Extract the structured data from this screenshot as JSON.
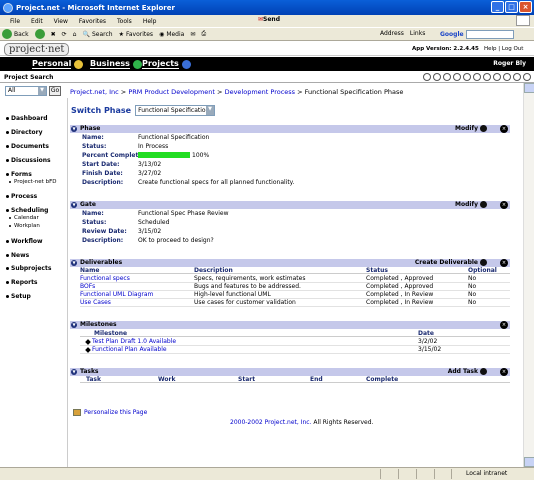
{
  "window": {
    "title": "Project.net - Microsoft Internet Explorer"
  },
  "browser_menu": [
    "File",
    "Edit",
    "View",
    "Favorites",
    "Tools",
    "Help"
  ],
  "send_brand": "Send",
  "toolbar": {
    "back": "Back",
    "search": "Search",
    "favorites": "Favorites",
    "media": "Media",
    "address": "Address",
    "links": "Links"
  },
  "google": {
    "label": "Google"
  },
  "app": {
    "logo": "project·net",
    "version": "App Version: 2.2.4.45",
    "help": "Help",
    "logout": "Log Out",
    "separator": "|"
  },
  "nav": {
    "personal": "Personal",
    "business": "Business",
    "projects": "Projects",
    "user": "Roger Bly"
  },
  "search": {
    "label": "Project Search",
    "scope": "All",
    "go": "Go"
  },
  "sidebar": {
    "dashboard": "Dashboard",
    "directory": "Directory",
    "documents": "Documents",
    "discussions": "Discussions",
    "forms": "Forms",
    "forms_sub": "Project-net bFD",
    "process": "Process",
    "scheduling": "Scheduling",
    "calendar": "Calendar",
    "workplan": "Workplan",
    "workflow": "Workflow",
    "news": "News",
    "subprojects": "Subprojects",
    "reports": "Reports",
    "setup": "Setup"
  },
  "breadcrumb": {
    "c1": "Project.net, Inc",
    "c2": "PRM Product Development",
    "c3": "Development Process",
    "c4": "Functional Specification Phase",
    "sep": ">"
  },
  "switch_phase": {
    "label": "Switch Phase",
    "value": "Functional Specification"
  },
  "phase": {
    "title": "Phase",
    "modify": "Modify",
    "name_k": "Name:",
    "name_v": "Functional Specification",
    "status_k": "Status:",
    "status_v": "In Process",
    "pct_k": "Percent Complete:",
    "pct_v": "100%",
    "pct_value": 1.0,
    "start_k": "Start Date:",
    "start_v": "3/13/02",
    "finish_k": "Finish Date:",
    "finish_v": "3/27/02",
    "desc_k": "Description:",
    "desc_v": "Create functional specs for all planned functionality."
  },
  "gate": {
    "title": "Gate",
    "modify": "Modify",
    "name_k": "Name:",
    "name_v": "Functional Spec Phase Review",
    "status_k": "Status:",
    "status_v": "Scheduled",
    "review_k": "Review Date:",
    "review_v": "3/15/02",
    "desc_k": "Description:",
    "desc_v": "OK to proceed to design?"
  },
  "deliverables": {
    "title": "Deliverables",
    "create": "Create Deliverable",
    "headers": [
      "Name",
      "Description",
      "Status",
      "Optional"
    ],
    "rows": [
      [
        "Functional specs",
        "Specs, requirements, work estimates",
        "Completed , Approved",
        "No"
      ],
      [
        "BOFs",
        "Bugs and features to be addressed.",
        "Completed , Approved",
        "No"
      ],
      [
        "Functional UML Diagram",
        "High-level functional UML",
        "Completed , In Review",
        "No"
      ],
      [
        "Use Cases",
        "Use cases for customer validation",
        "Completed , In Review",
        "No"
      ]
    ]
  },
  "milestones": {
    "title": "Milestones",
    "headers": [
      "Milestone",
      "Date"
    ],
    "rows": [
      [
        "Test Plan Draft 1.0 Available",
        "3/2/02"
      ],
      [
        "Functional Plan Available",
        "3/15/02"
      ]
    ]
  },
  "tasks": {
    "title": "Tasks",
    "add": "Add Task",
    "headers": [
      "Task",
      "Work",
      "Start",
      "End",
      "Complete"
    ]
  },
  "personalize": "Personalize this Page",
  "footer": {
    "link": "2000-2002 Project.net, Inc.",
    "rest": "All Rights Reserved."
  },
  "status": {
    "zone": "Local intranet"
  }
}
